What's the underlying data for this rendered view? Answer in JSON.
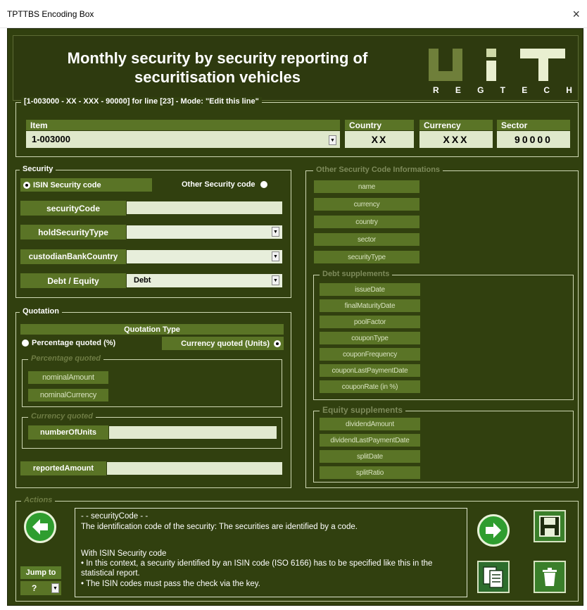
{
  "window": {
    "title": "TPTTBS Encoding Box",
    "close_glyph": "×"
  },
  "header": {
    "title": "Monthly security by security reporting of securitisation vehicles",
    "logo": {
      "letters": [
        "U",
        "I",
        "T"
      ],
      "subtitle_letters": [
        "R",
        "E",
        "G",
        "T",
        "E",
        "C",
        "H"
      ]
    }
  },
  "line": {
    "legend": "[1-003000 - XX - XXX - 90000] for line [23] - Mode: \"Edit this line\"",
    "item_header": "Item",
    "item_value": "1-003000",
    "country_header": "Country",
    "country_value": "XX",
    "currency_header": "Currency",
    "currency_value": "XXX",
    "sector_header": "Sector",
    "sector_value": "90000"
  },
  "security": {
    "legend": "Security",
    "isin_label": "ISIN Security code",
    "isin_selected": true,
    "other_label": "Other Security code",
    "security_code_label": "securityCode",
    "security_code_value": "",
    "hold_type_label": "holdSecurityType",
    "hold_type_value": "",
    "custodian_label": "custodianBankCountry",
    "custodian_value": "",
    "debt_equity_label": "Debt / Equity",
    "debt_equity_value": "Debt"
  },
  "quotation": {
    "legend": "Quotation",
    "type_header": "Quotation Type",
    "percentage_label": "Percentage quoted  (%)",
    "currency_label": "Currency quoted  (Units)",
    "currency_selected": true,
    "percentage_group": "Percentage quoted",
    "nominal_amount": "nominalAmount",
    "nominal_currency": "nominalCurrency",
    "currency_group": "Currency quoted",
    "number_of_units": "numberOfUnits",
    "reported_amount": "reportedAmount"
  },
  "other_info": {
    "legend": "Other Security Code Informations",
    "fields": [
      "name",
      "currency",
      "country",
      "sector",
      "securityType"
    ],
    "debt_legend": "Debt supplements",
    "debt_fields": [
      "issueDate",
      "finalMaturityDate",
      "poolFactor",
      "couponType",
      "couponFrequency",
      "couponLastPaymentDate",
      "couponRate (in %)"
    ],
    "equity_legend": "Equity supplements",
    "equity_fields": [
      "dividendAmount",
      "dividendLastPaymentDate",
      "splitDate",
      "splitRatio"
    ]
  },
  "actions": {
    "legend": "Actions",
    "jump_to_label": "Jump to",
    "jump_to_value": "?",
    "help_title": "- - securityCode - -",
    "help_line1": "The identification code of the security: The securities are identified by a code.",
    "help_line2": "With ISIN Security code",
    "help_line3": " • In this context, a security identified by an ISIN code (ISO 6166) has to be specified like this in the statistical report.",
    "help_line4": " • The ISIN codes must pass the check via the key."
  },
  "colors": {
    "background": "#31400f",
    "label_bg": "#5a7426",
    "input_bg": "#e1e9cf",
    "accent_green": "#2f9d2f"
  }
}
